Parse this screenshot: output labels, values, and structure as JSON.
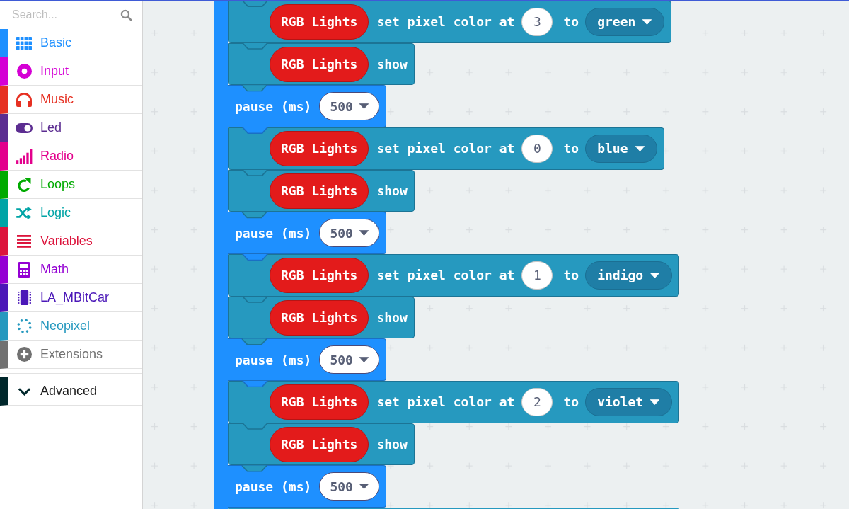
{
  "search": {
    "placeholder": "Search..."
  },
  "categories": [
    {
      "label": "Basic",
      "color": "#1e90ff",
      "selected": false
    },
    {
      "label": "Input",
      "color": "#d400d4",
      "selected": false
    },
    {
      "label": "Music",
      "color": "#e63022",
      "selected": false
    },
    {
      "label": "Led",
      "color": "#5c2d91",
      "selected": false
    },
    {
      "label": "Radio",
      "color": "#e3008c",
      "selected": false
    },
    {
      "label": "Loops",
      "color": "#00aa00",
      "selected": false
    },
    {
      "label": "Logic",
      "color": "#00a4a6",
      "selected": false
    },
    {
      "label": "Variables",
      "color": "#dc143c",
      "selected": false
    },
    {
      "label": "Math",
      "color": "#9400d3",
      "selected": false
    },
    {
      "label": "LA_MBitCar",
      "color": "#4b18b8",
      "selected": false
    },
    {
      "label": "Neopixel",
      "color": "#2699bf",
      "selected": false
    },
    {
      "label": "Extensions",
      "color": "#717171",
      "selected": false
    }
  ],
  "advanced": {
    "label": "Advanced",
    "color": "#00272b"
  },
  "blocks": [
    {
      "kind": "set_pixel",
      "target": "RGB Lights",
      "text": "set pixel color at",
      "index": "3",
      "joiner": "to",
      "option": "green"
    },
    {
      "kind": "show",
      "target": "RGB Lights",
      "text": "show"
    },
    {
      "kind": "pause",
      "text": "pause (ms)",
      "value": "500"
    },
    {
      "kind": "set_pixel",
      "target": "RGB Lights",
      "text": "set pixel color at",
      "index": "0",
      "joiner": "to",
      "option": "blue"
    },
    {
      "kind": "show",
      "target": "RGB Lights",
      "text": "show"
    },
    {
      "kind": "pause",
      "text": "pause (ms)",
      "value": "500"
    },
    {
      "kind": "set_pixel",
      "target": "RGB Lights",
      "text": "set pixel color at",
      "index": "1",
      "joiner": "to",
      "option": "indigo"
    },
    {
      "kind": "show",
      "target": "RGB Lights",
      "text": "show"
    },
    {
      "kind": "pause",
      "text": "pause (ms)",
      "value": "500"
    },
    {
      "kind": "set_pixel",
      "target": "RGB Lights",
      "text": "set pixel color at",
      "index": "2",
      "joiner": "to",
      "option": "violet"
    },
    {
      "kind": "show",
      "target": "RGB Lights",
      "text": "show"
    },
    {
      "kind": "pause",
      "text": "pause (ms)",
      "value": "500"
    },
    {
      "kind": "partial"
    }
  ]
}
